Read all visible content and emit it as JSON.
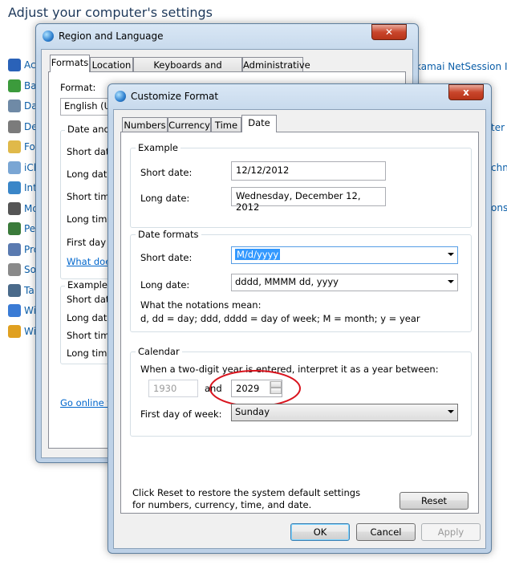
{
  "control_panel": {
    "title": "Adjust your computer's settings",
    "items": [
      {
        "label": "Ac",
        "icon": "flag-icon",
        "color": "#2a62b8"
      },
      {
        "label": "Ba",
        "icon": "backup-icon",
        "color": "#3c9b3c"
      },
      {
        "label": "Da",
        "icon": "devices-icon",
        "color": "#6f8aa6"
      },
      {
        "label": "De",
        "icon": "printer-icon",
        "color": "#7b7b7b"
      },
      {
        "label": "Fo",
        "icon": "folder-icon",
        "color": "#e0b94a"
      },
      {
        "label": "iCl",
        "icon": "cloud-icon",
        "color": "#7aa6d4"
      },
      {
        "label": "Int",
        "icon": "internet-options-icon",
        "color": "#3a86c8"
      },
      {
        "label": "Mo",
        "icon": "mouse-icon",
        "color": "#555555"
      },
      {
        "label": "Pe",
        "icon": "performance-icon",
        "color": "#3a7a3a"
      },
      {
        "label": "Pro",
        "icon": "programs-icon",
        "color": "#5a7ab0"
      },
      {
        "label": "So",
        "icon": "sound-icon",
        "color": "#8a8a8a"
      },
      {
        "label": "Ta",
        "icon": "taskbar-icon",
        "color": "#4a6a8a"
      },
      {
        "label": "Wi",
        "icon": "windows-icon",
        "color": "#3a7bd5"
      },
      {
        "label": "Wi",
        "icon": "windows-update-icon",
        "color": "#e0a020"
      }
    ],
    "right_items": [
      "kamai NetSession Inte",
      "ter",
      "chno",
      "ons"
    ]
  },
  "region_window": {
    "title": "Region and Language",
    "tabs": [
      "Formats",
      "Location",
      "Keyboards and Languages",
      "Administrative"
    ],
    "format_label": "Format:",
    "format_value": "English (Ur",
    "date_time_group": "Date and t",
    "rows": [
      "Short date",
      "Long date",
      "Short time",
      "Long time",
      "First day o"
    ],
    "link": "What doe",
    "examples_group": "Examples",
    "example_rows": [
      "Short date",
      "Long date",
      "Short time",
      "Long time"
    ],
    "go_online": "Go online to"
  },
  "customize_window": {
    "title": "Customize Format",
    "close": "x",
    "tabs": [
      "Numbers",
      "Currency",
      "Time",
      "Date"
    ],
    "example": {
      "group": "Example",
      "short_label": "Short date:",
      "short_value": "12/12/2012",
      "long_label": "Long date:",
      "long_value": "Wednesday, December 12, 2012"
    },
    "date_formats": {
      "group": "Date formats",
      "short_label": "Short date:",
      "short_value": "M/d/yyyy",
      "long_label": "Long date:",
      "long_value": "dddd, MMMM dd, yyyy",
      "notation_title": "What the notations mean:",
      "notation_text": "d, dd = day;  ddd, dddd = day of week;  M = month;  y = year"
    },
    "calendar": {
      "group": "Calendar",
      "prompt": "When a two-digit year is entered, interpret it as a year between:",
      "year_from": "1930",
      "and": "and",
      "year_to": "2029",
      "first_day_label": "First day of week:",
      "first_day_value": "Sunday"
    },
    "reset_note": "Click Reset to restore the system default settings for numbers, currency, time, and date.",
    "buttons": {
      "reset": "Reset",
      "ok": "OK",
      "cancel": "Cancel",
      "apply": "Apply"
    },
    "highlight_color": "#d9141e"
  }
}
